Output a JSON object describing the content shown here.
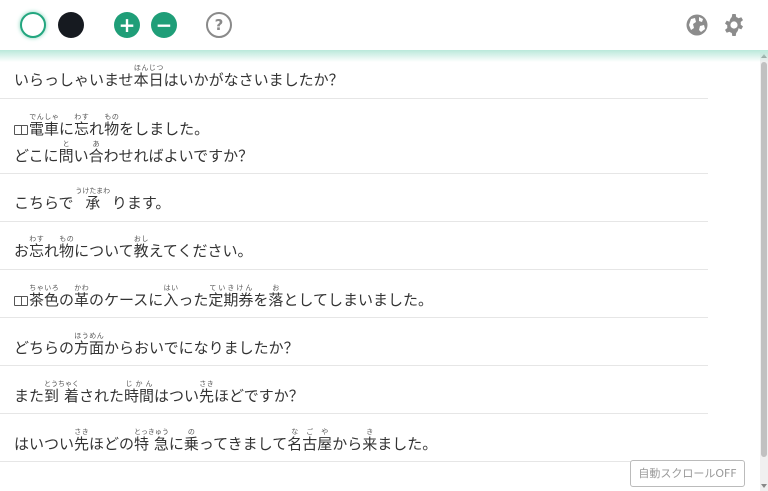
{
  "toolbar": {
    "plus_label": "+",
    "minus_label": "−",
    "help_label": "?",
    "icons": [
      "white-theme-icon",
      "black-theme-icon",
      "zoom-in-icon",
      "zoom-out-icon",
      "help-icon",
      "globe-icon",
      "gear-icon"
    ]
  },
  "sentences": [
    {
      "text": "いらっしゃいませ本日はいかがなさいましたか？",
      "ruby": [
        {
          "base": "本日",
          "rt": "ほんじつ"
        }
      ]
    },
    {
      "text": "電車に忘れ物をしました。",
      "book": true,
      "ruby": [
        {
          "base": "電車",
          "rt": "でんしゃ"
        },
        {
          "base": "忘",
          "rt": "わす"
        },
        {
          "base": "物",
          "rt": "もの"
        }
      ]
    },
    {
      "text": "どこに問い合わせればよいですか？",
      "ruby": [
        {
          "base": "問",
          "rt": "と"
        },
        {
          "base": "合",
          "rt": "あ"
        }
      ]
    },
    {
      "text": "こちらで 承 ります。",
      "ruby": [
        {
          "base": "承",
          "rt": "うけたまわ"
        }
      ]
    },
    {
      "text": "お忘れ物について教えてください。",
      "ruby": [
        {
          "base": "忘",
          "rt": "わす"
        },
        {
          "base": "物",
          "rt": "もの"
        },
        {
          "base": "教",
          "rt": "おし"
        }
      ]
    },
    {
      "text": "茶色の革のケースに入った定期券を落としてしまいました。",
      "book": true,
      "ruby": [
        {
          "base": "茶色",
          "rt": "ちゃいろ"
        },
        {
          "base": "革",
          "rt": "かわ"
        },
        {
          "base": "入",
          "rt": "はい"
        },
        {
          "base": "定期券",
          "rt": "ていきけん"
        },
        {
          "base": "落",
          "rt": "お"
        }
      ]
    },
    {
      "text": "どちらの方面からおいでになりましたか？",
      "ruby": [
        {
          "base": "方面",
          "rt": "ほうめん"
        }
      ]
    },
    {
      "text": "また到 着された時間はつい先ほどですか？",
      "ruby": [
        {
          "base": "到 着",
          "rt": "とうちゃく"
        },
        {
          "base": "時間",
          "rt": "じかん"
        },
        {
          "base": "先",
          "rt": "さき"
        }
      ]
    },
    {
      "text": "はいつい先ほどの特 急に乗ってきまして名古屋から来ました。",
      "ruby": [
        {
          "base": "先",
          "rt": "さき"
        },
        {
          "base": "特 急",
          "rt": "とっきゅう"
        },
        {
          "base": "乗",
          "rt": "の"
        },
        {
          "base": "名古屋",
          "rt": "なごや"
        },
        {
          "base": "来",
          "rt": "き"
        }
      ]
    }
  ],
  "autoscroll_label": "自動スクロールOFF",
  "colors": {
    "accent": "#1f9e78",
    "dark": "#161a20",
    "divider": "#e6e6e6"
  }
}
